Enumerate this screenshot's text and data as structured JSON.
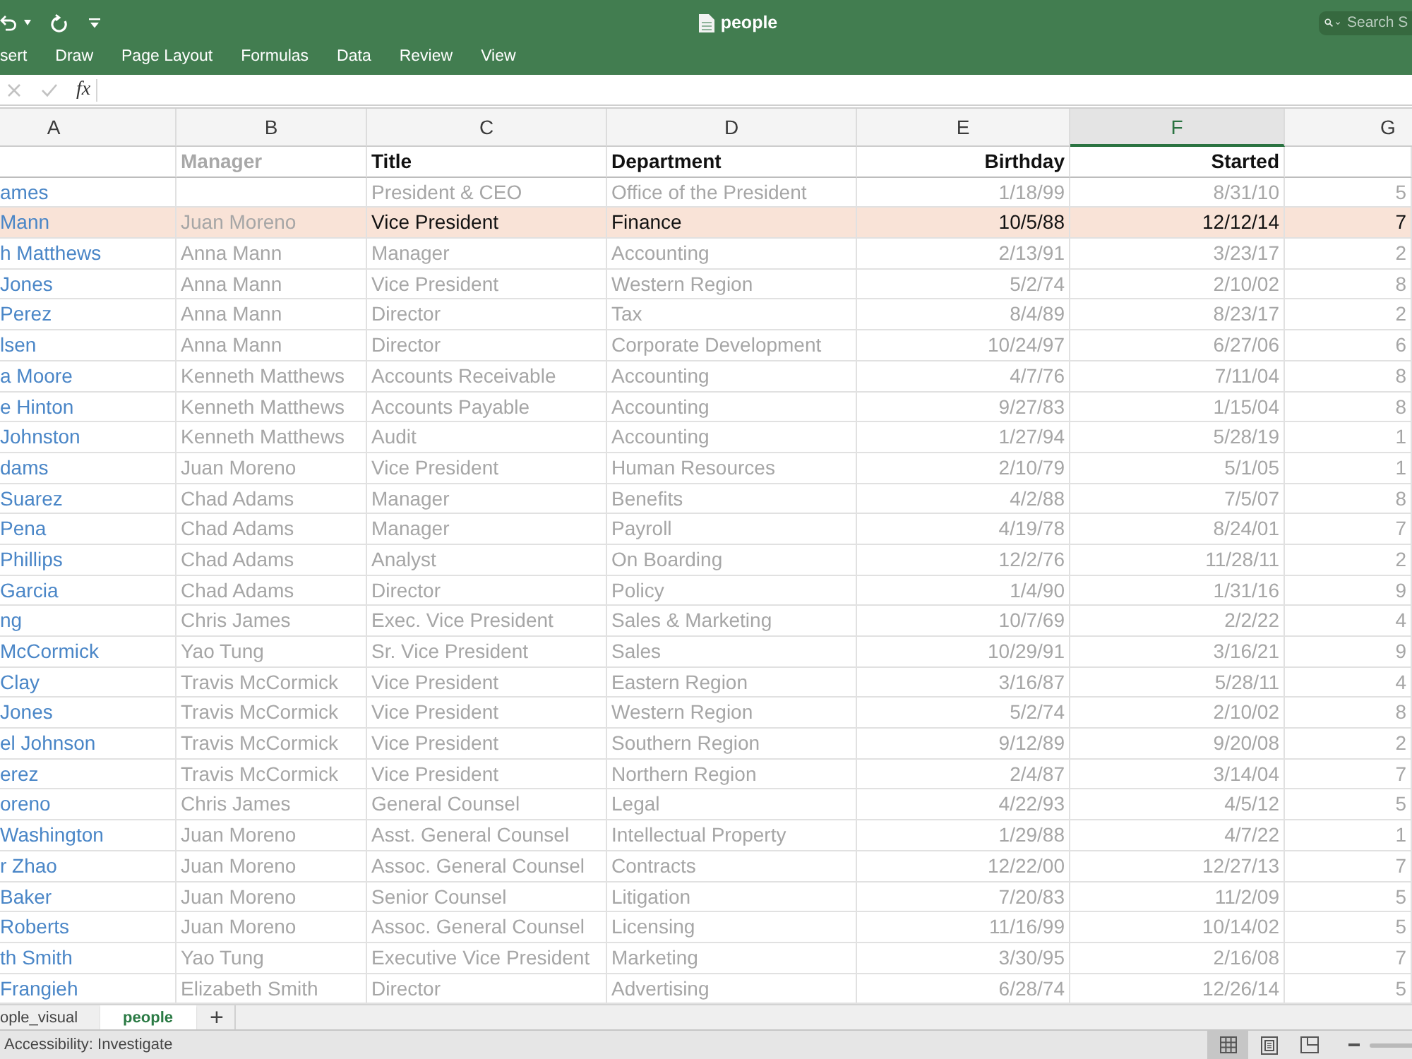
{
  "window": {
    "title": "people"
  },
  "search": {
    "placeholder": "Search S"
  },
  "ribbon_tabs": [
    {
      "label": "sert",
      "selected": false
    },
    {
      "label": "Draw",
      "selected": false
    },
    {
      "label": "Page Layout",
      "selected": false
    },
    {
      "label": "Formulas",
      "selected": false
    },
    {
      "label": "Data",
      "selected": false
    },
    {
      "label": "Review",
      "selected": false
    },
    {
      "label": "View",
      "selected": false
    }
  ],
  "formula_bar": {
    "buttons": [
      {
        "kind": "cancel",
        "disabled": true
      },
      {
        "kind": "enter",
        "disabled": true
      }
    ],
    "function_label": "fx"
  },
  "sheet": {
    "columns": [
      {
        "letter": "A",
        "selected": false,
        "kind": "link"
      },
      {
        "letter": "B",
        "selected": false,
        "kind": "muted",
        "heading": "Manager"
      },
      {
        "letter": "C",
        "selected": false,
        "kind": "text",
        "heading": "Title"
      },
      {
        "letter": "D",
        "selected": false,
        "kind": "text",
        "heading": "Department"
      },
      {
        "letter": "E",
        "selected": false,
        "kind": "date",
        "heading": "Birthday"
      },
      {
        "letter": "F",
        "selected": true,
        "kind": "date",
        "heading": "Started"
      },
      {
        "letter": "G",
        "selected": false,
        "kind": "number"
      }
    ],
    "rows": [
      {
        "highlighted": false,
        "cells": [
          "ames",
          null,
          "President & CEO",
          "Office of the President",
          "1/18/99",
          "8/31/10",
          "5"
        ]
      },
      {
        "highlighted": true,
        "cells": [
          "Mann",
          "Juan Moreno",
          "Vice President",
          "Finance",
          "10/5/88",
          "12/12/14",
          "7"
        ]
      },
      {
        "highlighted": false,
        "cells": [
          "h Matthews",
          "Anna Mann",
          "Manager",
          "Accounting",
          "2/13/91",
          "3/23/17",
          "2"
        ]
      },
      {
        "highlighted": false,
        "cells": [
          "Jones",
          "Anna Mann",
          "Vice President",
          "Western Region",
          "5/2/74",
          "2/10/02",
          "8"
        ]
      },
      {
        "highlighted": false,
        "cells": [
          "Perez",
          "Anna Mann",
          "Director",
          "Tax",
          "8/4/89",
          "8/23/17",
          "2"
        ]
      },
      {
        "highlighted": false,
        "cells": [
          "lsen",
          "Anna Mann",
          "Director",
          "Corporate Development",
          "10/24/97",
          "6/27/06",
          "6"
        ]
      },
      {
        "highlighted": false,
        "cells": [
          "a Moore",
          "Kenneth Matthews",
          "Accounts Receivable",
          "Accounting",
          "4/7/76",
          "7/11/04",
          "8"
        ]
      },
      {
        "highlighted": false,
        "cells": [
          "e Hinton",
          "Kenneth Matthews",
          "Accounts Payable",
          "Accounting",
          "9/27/83",
          "1/15/04",
          "8"
        ]
      },
      {
        "highlighted": false,
        "cells": [
          "Johnston",
          "Kenneth Matthews",
          "Audit",
          "Accounting",
          "1/27/94",
          "5/28/19",
          "1"
        ]
      },
      {
        "highlighted": false,
        "cells": [
          "dams",
          "Juan Moreno",
          "Vice President",
          "Human Resources",
          "2/10/79",
          "5/1/05",
          "1"
        ]
      },
      {
        "highlighted": false,
        "cells": [
          "Suarez",
          "Chad Adams",
          "Manager",
          "Benefits",
          "4/2/88",
          "7/5/07",
          "8"
        ]
      },
      {
        "highlighted": false,
        "cells": [
          "Pena",
          "Chad Adams",
          "Manager",
          "Payroll",
          "4/19/78",
          "8/24/01",
          "7"
        ]
      },
      {
        "highlighted": false,
        "cells": [
          "Phillips",
          "Chad Adams",
          "Analyst",
          "On Boarding",
          "12/2/76",
          "11/28/11",
          "2"
        ]
      },
      {
        "highlighted": false,
        "cells": [
          "Garcia",
          "Chad Adams",
          "Director",
          "Policy",
          "1/4/90",
          "1/31/16",
          "9"
        ]
      },
      {
        "highlighted": false,
        "cells": [
          "ng",
          "Chris James",
          "Exec. Vice President",
          "Sales & Marketing",
          "10/7/69",
          "2/2/22",
          "4"
        ]
      },
      {
        "highlighted": false,
        "cells": [
          "McCormick",
          "Yao Tung",
          "Sr. Vice President",
          "Sales",
          "10/29/91",
          "3/16/21",
          "9"
        ]
      },
      {
        "highlighted": false,
        "cells": [
          "Clay",
          "Travis McCormick",
          "Vice President",
          "Eastern Region",
          "3/16/87",
          "5/28/11",
          "4"
        ]
      },
      {
        "highlighted": false,
        "cells": [
          "Jones",
          "Travis McCormick",
          "Vice President",
          "Western Region",
          "5/2/74",
          "2/10/02",
          "8"
        ]
      },
      {
        "highlighted": false,
        "cells": [
          "el Johnson",
          "Travis McCormick",
          "Vice President",
          "Southern Region",
          "9/12/89",
          "9/20/08",
          "2"
        ]
      },
      {
        "highlighted": false,
        "cells": [
          "erez",
          "Travis McCormick",
          "Vice President",
          "Northern Region",
          "2/4/87",
          "3/14/04",
          "7"
        ]
      },
      {
        "highlighted": false,
        "cells": [
          "oreno",
          "Chris James",
          "General Counsel",
          "Legal",
          "4/22/93",
          "4/5/12",
          "5"
        ]
      },
      {
        "highlighted": false,
        "cells": [
          "Washington",
          "Juan Moreno",
          "Asst. General Counsel",
          "Intellectual Property",
          "1/29/88",
          "4/7/22",
          "1"
        ]
      },
      {
        "highlighted": false,
        "cells": [
          "r Zhao",
          "Juan Moreno",
          "Assoc. General Counsel",
          "Contracts",
          "12/22/00",
          "12/27/13",
          "7"
        ]
      },
      {
        "highlighted": false,
        "cells": [
          "Baker",
          "Juan Moreno",
          "Senior Counsel",
          "Litigation",
          "7/20/83",
          "11/2/09",
          "5"
        ]
      },
      {
        "highlighted": false,
        "cells": [
          "Roberts",
          "Juan Moreno",
          "Assoc. General Counsel",
          "Licensing",
          "11/16/99",
          "10/14/02",
          "5"
        ]
      },
      {
        "highlighted": false,
        "cells": [
          "th Smith",
          "Yao Tung",
          "Executive Vice President",
          "Marketing",
          "3/30/95",
          "2/16/08",
          "7"
        ]
      },
      {
        "highlighted": false,
        "cells": [
          "Frangieh",
          "Elizabeth Smith",
          "Director",
          "Advertising",
          "6/28/74",
          "12/26/14",
          "5"
        ]
      }
    ]
  },
  "sheet_tabs": [
    {
      "label": "ople_visual",
      "selected": false
    },
    {
      "label": "people",
      "selected": true
    }
  ],
  "add_sheet": "+",
  "status_bar": {
    "accessibility": "Accessibility: Investigate",
    "view_buttons": [
      {
        "kind": "normal",
        "selected": true
      },
      {
        "kind": "page_layout",
        "selected": false
      },
      {
        "kind": "page_break",
        "selected": false
      }
    ]
  }
}
